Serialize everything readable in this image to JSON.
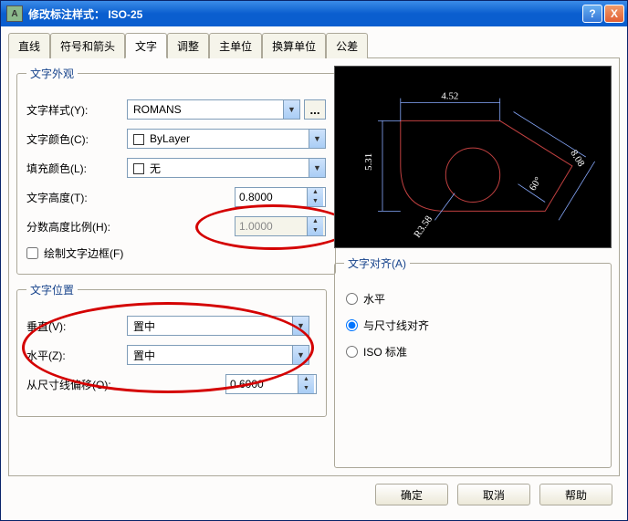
{
  "window": {
    "title": "修改标注样式： ISO-25",
    "help_glyph": "?",
    "close_glyph": "X"
  },
  "tabs": {
    "lines": "直线",
    "symbols": "符号和箭头",
    "text": "文字",
    "fit": "调整",
    "primary": "主单位",
    "alt": "换算单位",
    "tol": "公差"
  },
  "appearance": {
    "legend": "文字外观",
    "style_label": "文字样式(Y):",
    "style_value": "ROMANS",
    "style_more": "...",
    "color_label": "文字颜色(C):",
    "color_value": "ByLayer",
    "fill_label": "填充颜色(L):",
    "fill_value": "无",
    "height_label": "文字高度(T):",
    "height_value": "0.8000",
    "frac_label": "分数高度比例(H):",
    "frac_value": "1.0000",
    "frame_label": "绘制文字边框(F)"
  },
  "placement": {
    "legend": "文字位置",
    "vert_label": "垂直(V):",
    "vert_value": "置中",
    "horiz_label": "水平(Z):",
    "horiz_value": "置中",
    "offset_label": "从尺寸线偏移(O):",
    "offset_value": "0.6000"
  },
  "alignment": {
    "legend": "文字对齐(A)",
    "opt1": "水平",
    "opt2": "与尺寸线对齐",
    "opt3": "ISO 标准"
  },
  "preview": {
    "dim1": "4.52",
    "dim2": "5.31",
    "dim3": "8.08",
    "dim4": "60°",
    "dim5": "R3.58"
  },
  "footer": {
    "ok": "确定",
    "cancel": "取消",
    "help": "帮助"
  }
}
